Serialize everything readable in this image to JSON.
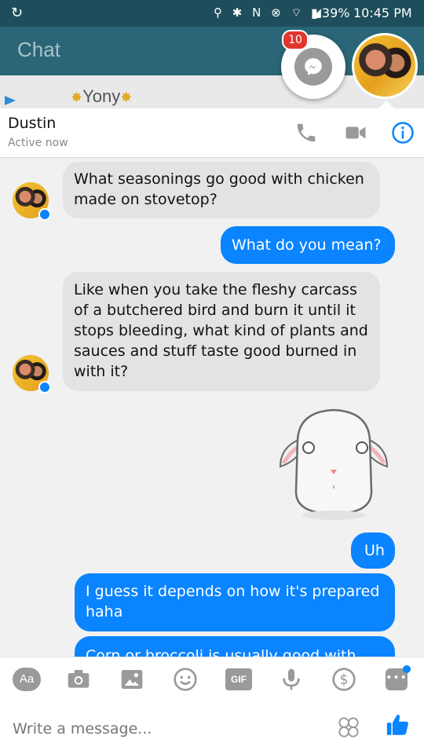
{
  "status_bar": {
    "left_icon": "sync-icon",
    "icons": "⚲ ✱ N ⊗ ⌔ ◢",
    "battery": "39%",
    "time": "10:45 PM"
  },
  "background_app": {
    "title": "Chat",
    "row_name": "Yony"
  },
  "chat_head": {
    "badge_count": "10",
    "messenger_icon": "messenger-icon"
  },
  "conversation": {
    "contact_name": "Dustin ",
    "contact_status": "Active now",
    "messages": [
      {
        "from": "them",
        "text": "What seasonings go good with chicken made on stovetop?"
      },
      {
        "from": "me",
        "text": "What do you mean?"
      },
      {
        "from": "them",
        "text": "Like when you take the fleshy carcass of a butchered bird and burn it until it stops bleeding, what kind of plants and sauces and stuff taste good burned in with it?"
      },
      {
        "from": "me",
        "type": "sticker",
        "sticker": "white-bunny-sticker"
      },
      {
        "from": "me",
        "text": "Uh"
      },
      {
        "from": "me",
        "text": "I guess it depends on how it's prepared haha"
      },
      {
        "from": "me",
        "text": "Corn or broccoli is usually good with"
      }
    ]
  },
  "composer": {
    "toolbar": {
      "aa_label": "Aa",
      "gif_label": "GIF"
    },
    "placeholder": "Write a message..."
  },
  "colors": {
    "outgoing": "#0a84ff",
    "incoming": "#e3e3e4",
    "status_bar": "#1e4d5c"
  }
}
